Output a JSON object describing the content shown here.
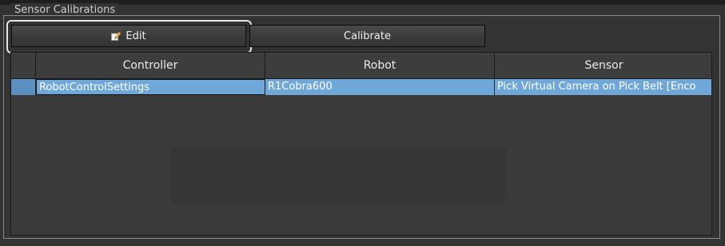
{
  "panel": {
    "title": "Sensor Calibrations"
  },
  "toolbar": {
    "edit_label": "Edit",
    "edit_icon": "edit-pencil-icon",
    "calibrate_label": "Calibrate"
  },
  "table": {
    "columns": [
      "Controller",
      "Robot",
      "Sensor"
    ],
    "rows": [
      {
        "controller": "RobotControlSettings",
        "robot": "R1Cobra600",
        "sensor": "Pick Virtual Camera on Pick Belt [Enco"
      }
    ],
    "selected_row": 0
  },
  "colors": {
    "background": "#333333",
    "selection": "#6fa8d8",
    "button": "#3e3e3e"
  }
}
